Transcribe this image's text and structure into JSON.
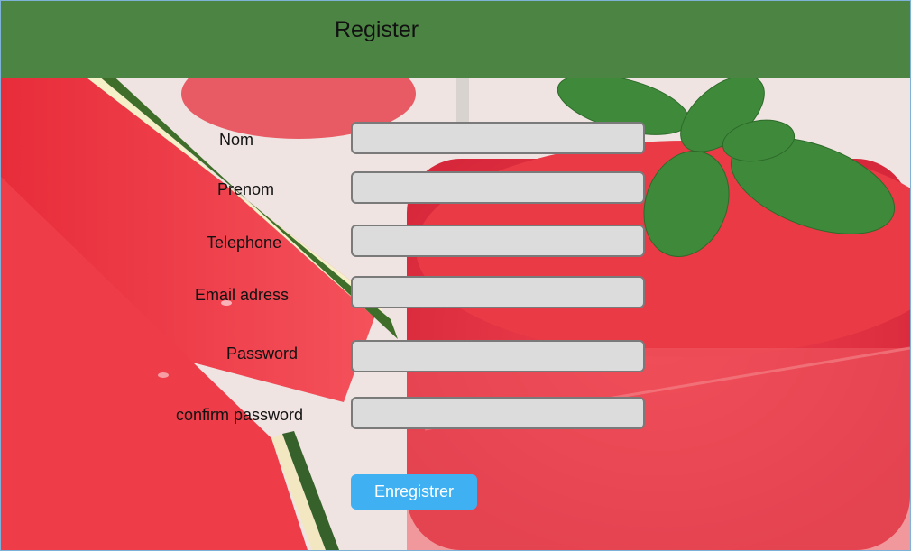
{
  "header": {
    "title": "Register",
    "color": "#4c8543"
  },
  "background": {
    "description_icon": "watermelon-juice-photo"
  },
  "form": {
    "fields": [
      {
        "label": "Nom",
        "value": "",
        "placeholder": ""
      },
      {
        "label": "Prenom",
        "value": "",
        "placeholder": ""
      },
      {
        "label": "Telephone",
        "value": "",
        "placeholder": ""
      },
      {
        "label": "Email adress",
        "value": "",
        "placeholder": ""
      },
      {
        "label": "Password",
        "value": "",
        "placeholder": ""
      },
      {
        "label": "confirm password",
        "value": "",
        "placeholder": ""
      }
    ],
    "submit_label": "Enregistrer",
    "submit_color": "#3fb0f2"
  }
}
